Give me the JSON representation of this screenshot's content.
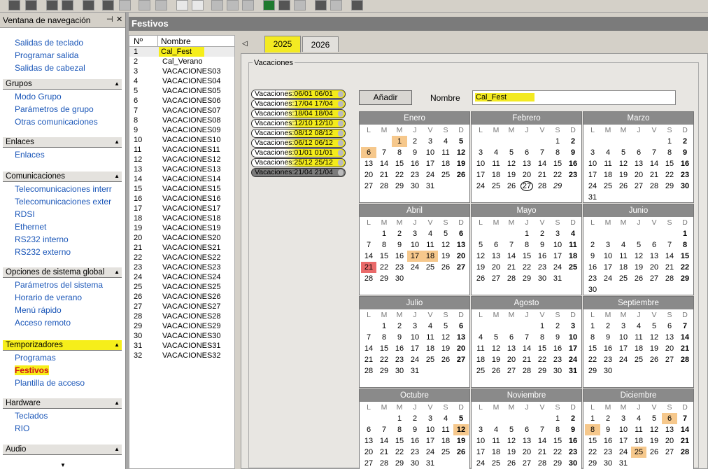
{
  "nav": {
    "title": "Ventana de navegación",
    "pin": "🗝",
    "close": "✕",
    "top_items": [
      "Salidas de teclado",
      "Programar salida",
      "Salidas de cabezal"
    ],
    "groups": [
      {
        "name": "Grupos",
        "items": [
          "Modo Grupo",
          "Parámetros de grupo",
          "Otras comunicaciones"
        ]
      },
      {
        "name": "Enlaces",
        "items": [
          "Enlaces"
        ]
      },
      {
        "name": "Comunicaciones",
        "items": [
          "Telecomunicaciones interr",
          "Telecomunicaciones exter",
          "RDSI",
          "Ethernet",
          "RS232 interno",
          "RS232 externo"
        ]
      },
      {
        "name": "Opciones de sistema global",
        "items": [
          "Parámetros del sistema",
          "Horario de verano",
          "Menú rápido",
          "Acceso remoto"
        ]
      },
      {
        "name": "Temporizadores",
        "items": [
          "Programas",
          "Festivos",
          "Plantilla de acceso"
        ]
      },
      {
        "name": "Hardware",
        "items": [
          "Teclados",
          "RIO"
        ]
      },
      {
        "name": "Audio",
        "items": []
      }
    ]
  },
  "main": {
    "title": "Festivos"
  },
  "list": {
    "col_no": "Nº",
    "col_name": "Nombre",
    "rows": [
      [
        "1",
        "Cal_Fest"
      ],
      [
        "2",
        "Cal_Verano"
      ],
      [
        "3",
        "VACACIONES03"
      ],
      [
        "4",
        "VACACIONES04"
      ],
      [
        "5",
        "VACACIONES05"
      ],
      [
        "6",
        "VACACIONES06"
      ],
      [
        "7",
        "VACACIONES07"
      ],
      [
        "8",
        "VACACIONES08"
      ],
      [
        "9",
        "VACACIONES09"
      ],
      [
        "10",
        "VACACIONES10"
      ],
      [
        "11",
        "VACACIONES11"
      ],
      [
        "12",
        "VACACIONES12"
      ],
      [
        "13",
        "VACACIONES13"
      ],
      [
        "14",
        "VACACIONES14"
      ],
      [
        "15",
        "VACACIONES15"
      ],
      [
        "16",
        "VACACIONES16"
      ],
      [
        "17",
        "VACACIONES17"
      ],
      [
        "18",
        "VACACIONES18"
      ],
      [
        "19",
        "VACACIONES19"
      ],
      [
        "20",
        "VACACIONES20"
      ],
      [
        "21",
        "VACACIONES21"
      ],
      [
        "22",
        "VACACIONES22"
      ],
      [
        "23",
        "VACACIONES23"
      ],
      [
        "24",
        "VACACIONES24"
      ],
      [
        "25",
        "VACACIONES25"
      ],
      [
        "26",
        "VACACIONES26"
      ],
      [
        "27",
        "VACACIONES27"
      ],
      [
        "28",
        "VACACIONES28"
      ],
      [
        "29",
        "VACACIONES29"
      ],
      [
        "30",
        "VACACIONES30"
      ],
      [
        "31",
        "VACACIONES31"
      ],
      [
        "32",
        "VACACIONES32"
      ]
    ]
  },
  "tabs": [
    "2025",
    "2026"
  ],
  "vacations": {
    "legend": "Vacaciones",
    "items": [
      "Vacaciones:06/01 06/01",
      "Vacaciones:17/04 17/04",
      "Vacaciones:18/04 18/04",
      "Vacaciones:12/10 12/10",
      "Vacaciones:08/12 08/12",
      "Vacaciones:06/12 06/12",
      "Vacaciones:01/01 01/01",
      "Vacaciones:25/12 25/12",
      "Vacaciones:21/04 21/04"
    ]
  },
  "form": {
    "add_label": "Añadir",
    "name_label": "Nombre",
    "name_value": "Cal_Fest"
  },
  "calendar": {
    "day_headers": [
      "L",
      "M",
      "M",
      "J",
      "V",
      "S",
      "D"
    ],
    "months": [
      {
        "name": "Enero",
        "offset": 2,
        "days": 31,
        "orange": [
          1,
          6
        ],
        "red": [],
        "circle": [],
        "italic": []
      },
      {
        "name": "Febrero",
        "offset": 5,
        "days": 28,
        "orange": [],
        "red": [],
        "circle": [],
        "italic": []
      },
      {
        "name": "Marzo",
        "offset": 5,
        "days": 31,
        "orange": [],
        "red": [],
        "circle": [],
        "italic": []
      },
      {
        "name": "Abril",
        "offset": 1,
        "days": 30,
        "orange": [
          17,
          18
        ],
        "red": [
          21
        ],
        "circle": [],
        "italic": []
      },
      {
        "name": "Mayo",
        "offset": 3,
        "days": 31,
        "orange": [],
        "red": [],
        "circle": [],
        "italic": []
      },
      {
        "name": "Junio",
        "offset": 6,
        "days": 30,
        "orange": [],
        "red": [],
        "circle": [],
        "italic": []
      },
      {
        "name": "Julio",
        "offset": 1,
        "days": 31,
        "orange": [],
        "red": [],
        "circle": [],
        "italic": []
      },
      {
        "name": "Agosto",
        "offset": 4,
        "days": 31,
        "orange": [],
        "red": [],
        "circle": [],
        "italic": []
      },
      {
        "name": "Septiembre",
        "offset": 0,
        "days": 30,
        "orange": [],
        "red": [],
        "circle": [],
        "italic": []
      },
      {
        "name": "Octubre",
        "offset": 2,
        "days": 31,
        "orange": [
          12
        ],
        "red": [],
        "circle": [],
        "italic": []
      },
      {
        "name": "Noviembre",
        "offset": 5,
        "days": 30,
        "orange": [],
        "red": [],
        "circle": [],
        "italic": []
      },
      {
        "name": "Diciembre",
        "offset": 0,
        "days": 31,
        "orange": [
          6,
          8,
          25
        ],
        "red": [],
        "circle": [],
        "italic": []
      }
    ],
    "feb_circle": 27,
    "feb_italic": 29
  }
}
